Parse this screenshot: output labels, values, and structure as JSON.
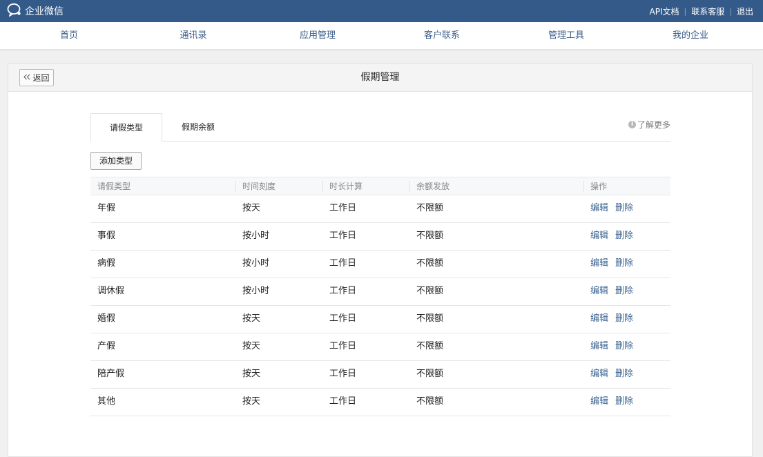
{
  "app": {
    "logo_text": "企业微信",
    "top_links": [
      "API文档",
      "联系客服",
      "退出"
    ]
  },
  "nav": [
    "首页",
    "通讯录",
    "应用管理",
    "客户联系",
    "管理工具",
    "我的企业"
  ],
  "page": {
    "back_label": "返回",
    "title": "假期管理"
  },
  "tabs": [
    "请假类型",
    "假期余额"
  ],
  "learn_more": "了解更多",
  "add_button": "添加类型",
  "table": {
    "headers": [
      "请假类型",
      "时间刻度",
      "时长计算",
      "余额发放",
      "操作"
    ],
    "rows": [
      {
        "type": "年假",
        "scale": "按天",
        "calc": "工作日",
        "balance": "不限额"
      },
      {
        "type": "事假",
        "scale": "按小时",
        "calc": "工作日",
        "balance": "不限额"
      },
      {
        "type": "病假",
        "scale": "按小时",
        "calc": "工作日",
        "balance": "不限额"
      },
      {
        "type": "调休假",
        "scale": "按小时",
        "calc": "工作日",
        "balance": "不限额"
      },
      {
        "type": "婚假",
        "scale": "按天",
        "calc": "工作日",
        "balance": "不限额"
      },
      {
        "type": "产假",
        "scale": "按天",
        "calc": "工作日",
        "balance": "不限额"
      },
      {
        "type": "陪产假",
        "scale": "按天",
        "calc": "工作日",
        "balance": "不限额"
      },
      {
        "type": "其他",
        "scale": "按天",
        "calc": "工作日",
        "balance": "不限额"
      }
    ],
    "edit_label": "编辑",
    "delete_label": "删除"
  },
  "colors": {
    "topbar": "#345a8a",
    "nav_text": "#3b5d8a",
    "link": "#3d6592"
  }
}
